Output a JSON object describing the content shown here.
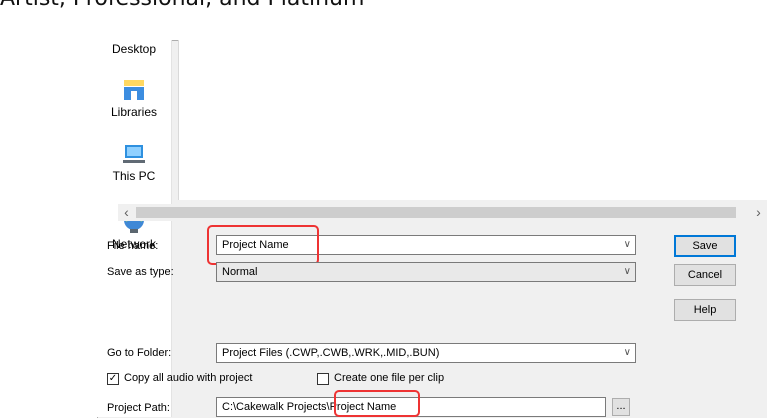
{
  "heading": "Artist, Professional, and Platinum",
  "places": [
    {
      "label": "Desktop",
      "icon": "desktop-icon"
    },
    {
      "label": "Libraries",
      "icon": "libraries-icon"
    },
    {
      "label": "This PC",
      "icon": "this-pc-icon"
    },
    {
      "label": "Network",
      "icon": "network-icon"
    }
  ],
  "form": {
    "file_name_label": "File name:",
    "file_name_value": "Project Name",
    "save_type_label": "Save as type:",
    "save_type_value": "Normal",
    "go_to_folder_label": "Go to Folder:",
    "go_to_folder_value": "Project Files (.CWP,.CWB,.WRK,.MID,.BUN)",
    "copy_audio_label": "Copy all audio with project",
    "copy_audio_checked": true,
    "one_file_label": "Create one file per clip",
    "one_file_checked": false,
    "project_path_label": "Project Path:",
    "project_path_value": "C:\\Cakewalk Projects\\Project Name"
  },
  "buttons": {
    "save": "Save",
    "cancel": "Cancel",
    "help": "Help",
    "browse": "..."
  },
  "scroll": {
    "left": "‹",
    "right": "›"
  },
  "colors": {
    "highlight": "#e33333",
    "default_button": "#0078d7"
  }
}
